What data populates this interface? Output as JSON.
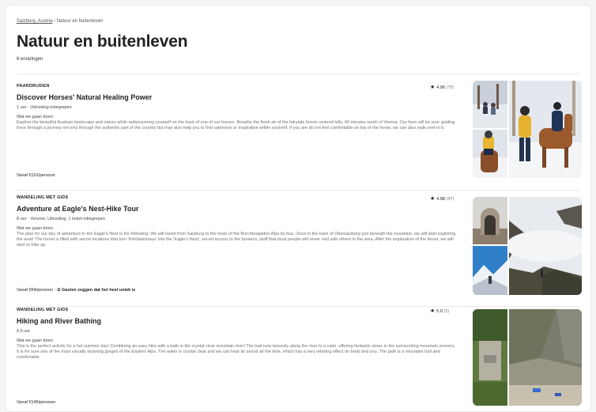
{
  "breadcrumb": {
    "parent": "Salzburg, Austria",
    "separator": "›",
    "current": "Natuur en buitenleven"
  },
  "page": {
    "title": "Natuur en buitenleven",
    "count": "6 ervaringen"
  },
  "experiences": [
    {
      "category": "PAARDRIJDEN",
      "rating": "4.96",
      "reviews": "(75)",
      "name": "Discover Horses' Natural Healing Power",
      "meta": "1 uur · Uitrusting inbegrepen",
      "what_label": "Wat we gaan doen:",
      "description": "Explore the beautiful Austrian landscape and nature while rediscovering yourself on the back of one of our horses. Breathe the fresh air of the fairytale forest covered hills, 40 minutes south of Vienna. Our farm will be your guiding force through a journey not only through the authentic part of the country but may also help you to find calmness or inspiration within yourself. If you are do not feel comfortable on top of the horse, we can also walk next to it.",
      "price": "Vanaf €110/persoon",
      "note": ""
    },
    {
      "category": "WANDELING MET GIDS",
      "rating": "4.98",
      "reviews": "(47)",
      "name": "Adventure at Eagle's Nest-Hike Tour",
      "meta": "8 uur · Vervoer, Uitrusting, 1 ticket inbegrepen",
      "what_label": "Wat we gaan doen:",
      "description": "The plan for our day of adventure in the Eagle's Nest is the following: We will travel from Salzburg to the heart of the Berchtesgaden Alps by bus. Once in the town of Obersalzberg just beneath the mountain, we will start exploring the area! The forest is filled with secret locations that turn 'Kehlsteinhaus' into the 'Eagle's Nest', secret access to the bunkers, stuff that most people will never visit with others in the area. After the exploration of the forest, we will start to hike up.",
      "price": "Vanaf €64/persoon",
      "note": "Gasten zeggen dat het heel uniek is"
    },
    {
      "category": "WANDELING MET GIDS",
      "rating": "5.0",
      "reviews": "(2)",
      "name": "Hiking and River Bathing",
      "meta": "6.5 uur",
      "what_label": "Wat we gaan doen:",
      "description": "This is the perfect activity for a hot summer day! Combining an easy hike with a bath in the crystal clear mountain river! The trail runs leisurely along the river to a calm, offering fantastic views to the surrounding mountain scenery. It is for sure one of the most visually stunning gorges of the Eastern Alps. The water is crystal clear and we can hear its sound all the time, which has a very relaxing effect on body and you. The path is a mountain trail and comfortable.",
      "price": "Vanaf €145/persoon",
      "note": ""
    }
  ],
  "colors": {
    "title": "#222222",
    "muted": "#6f6f6f",
    "separator": "#ebebeb",
    "star": "#222222"
  },
  "icons": {
    "rating": "star-icon",
    "note": "sparkle-icon"
  }
}
